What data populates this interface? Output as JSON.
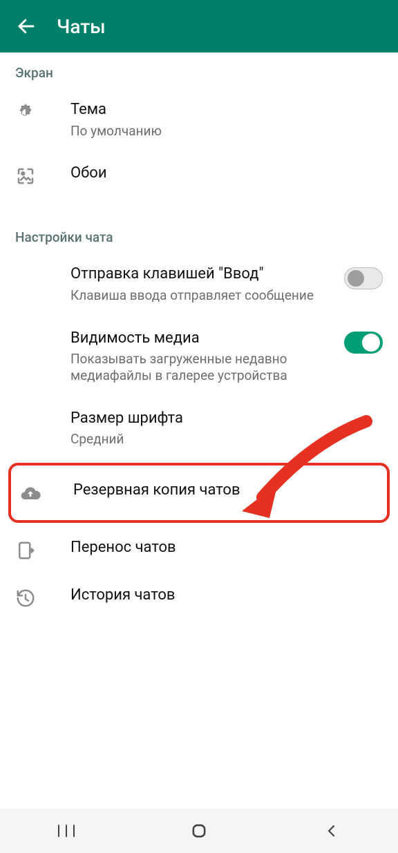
{
  "header": {
    "title": "Чаты"
  },
  "sections": {
    "display": {
      "header": "Экран",
      "theme": {
        "title": "Тема",
        "sub": "По умолчанию"
      },
      "wallpaper": {
        "title": "Обои"
      }
    },
    "chatSettings": {
      "header": "Настройки чата",
      "enterSend": {
        "title": "Отправка клавишей \"Ввод\"",
        "sub": "Клавиша ввода отправляет сообщение",
        "on": false
      },
      "mediaVisibility": {
        "title": "Видимость медиа",
        "sub": "Показывать загруженные недавно медиафайлы в галерее устройства",
        "on": true
      },
      "fontSize": {
        "title": "Размер шрифта",
        "sub": "Средний"
      },
      "backup": {
        "title": "Резервная копия чатов"
      },
      "transfer": {
        "title": "Перенос чатов"
      },
      "history": {
        "title": "История чатов"
      }
    }
  }
}
